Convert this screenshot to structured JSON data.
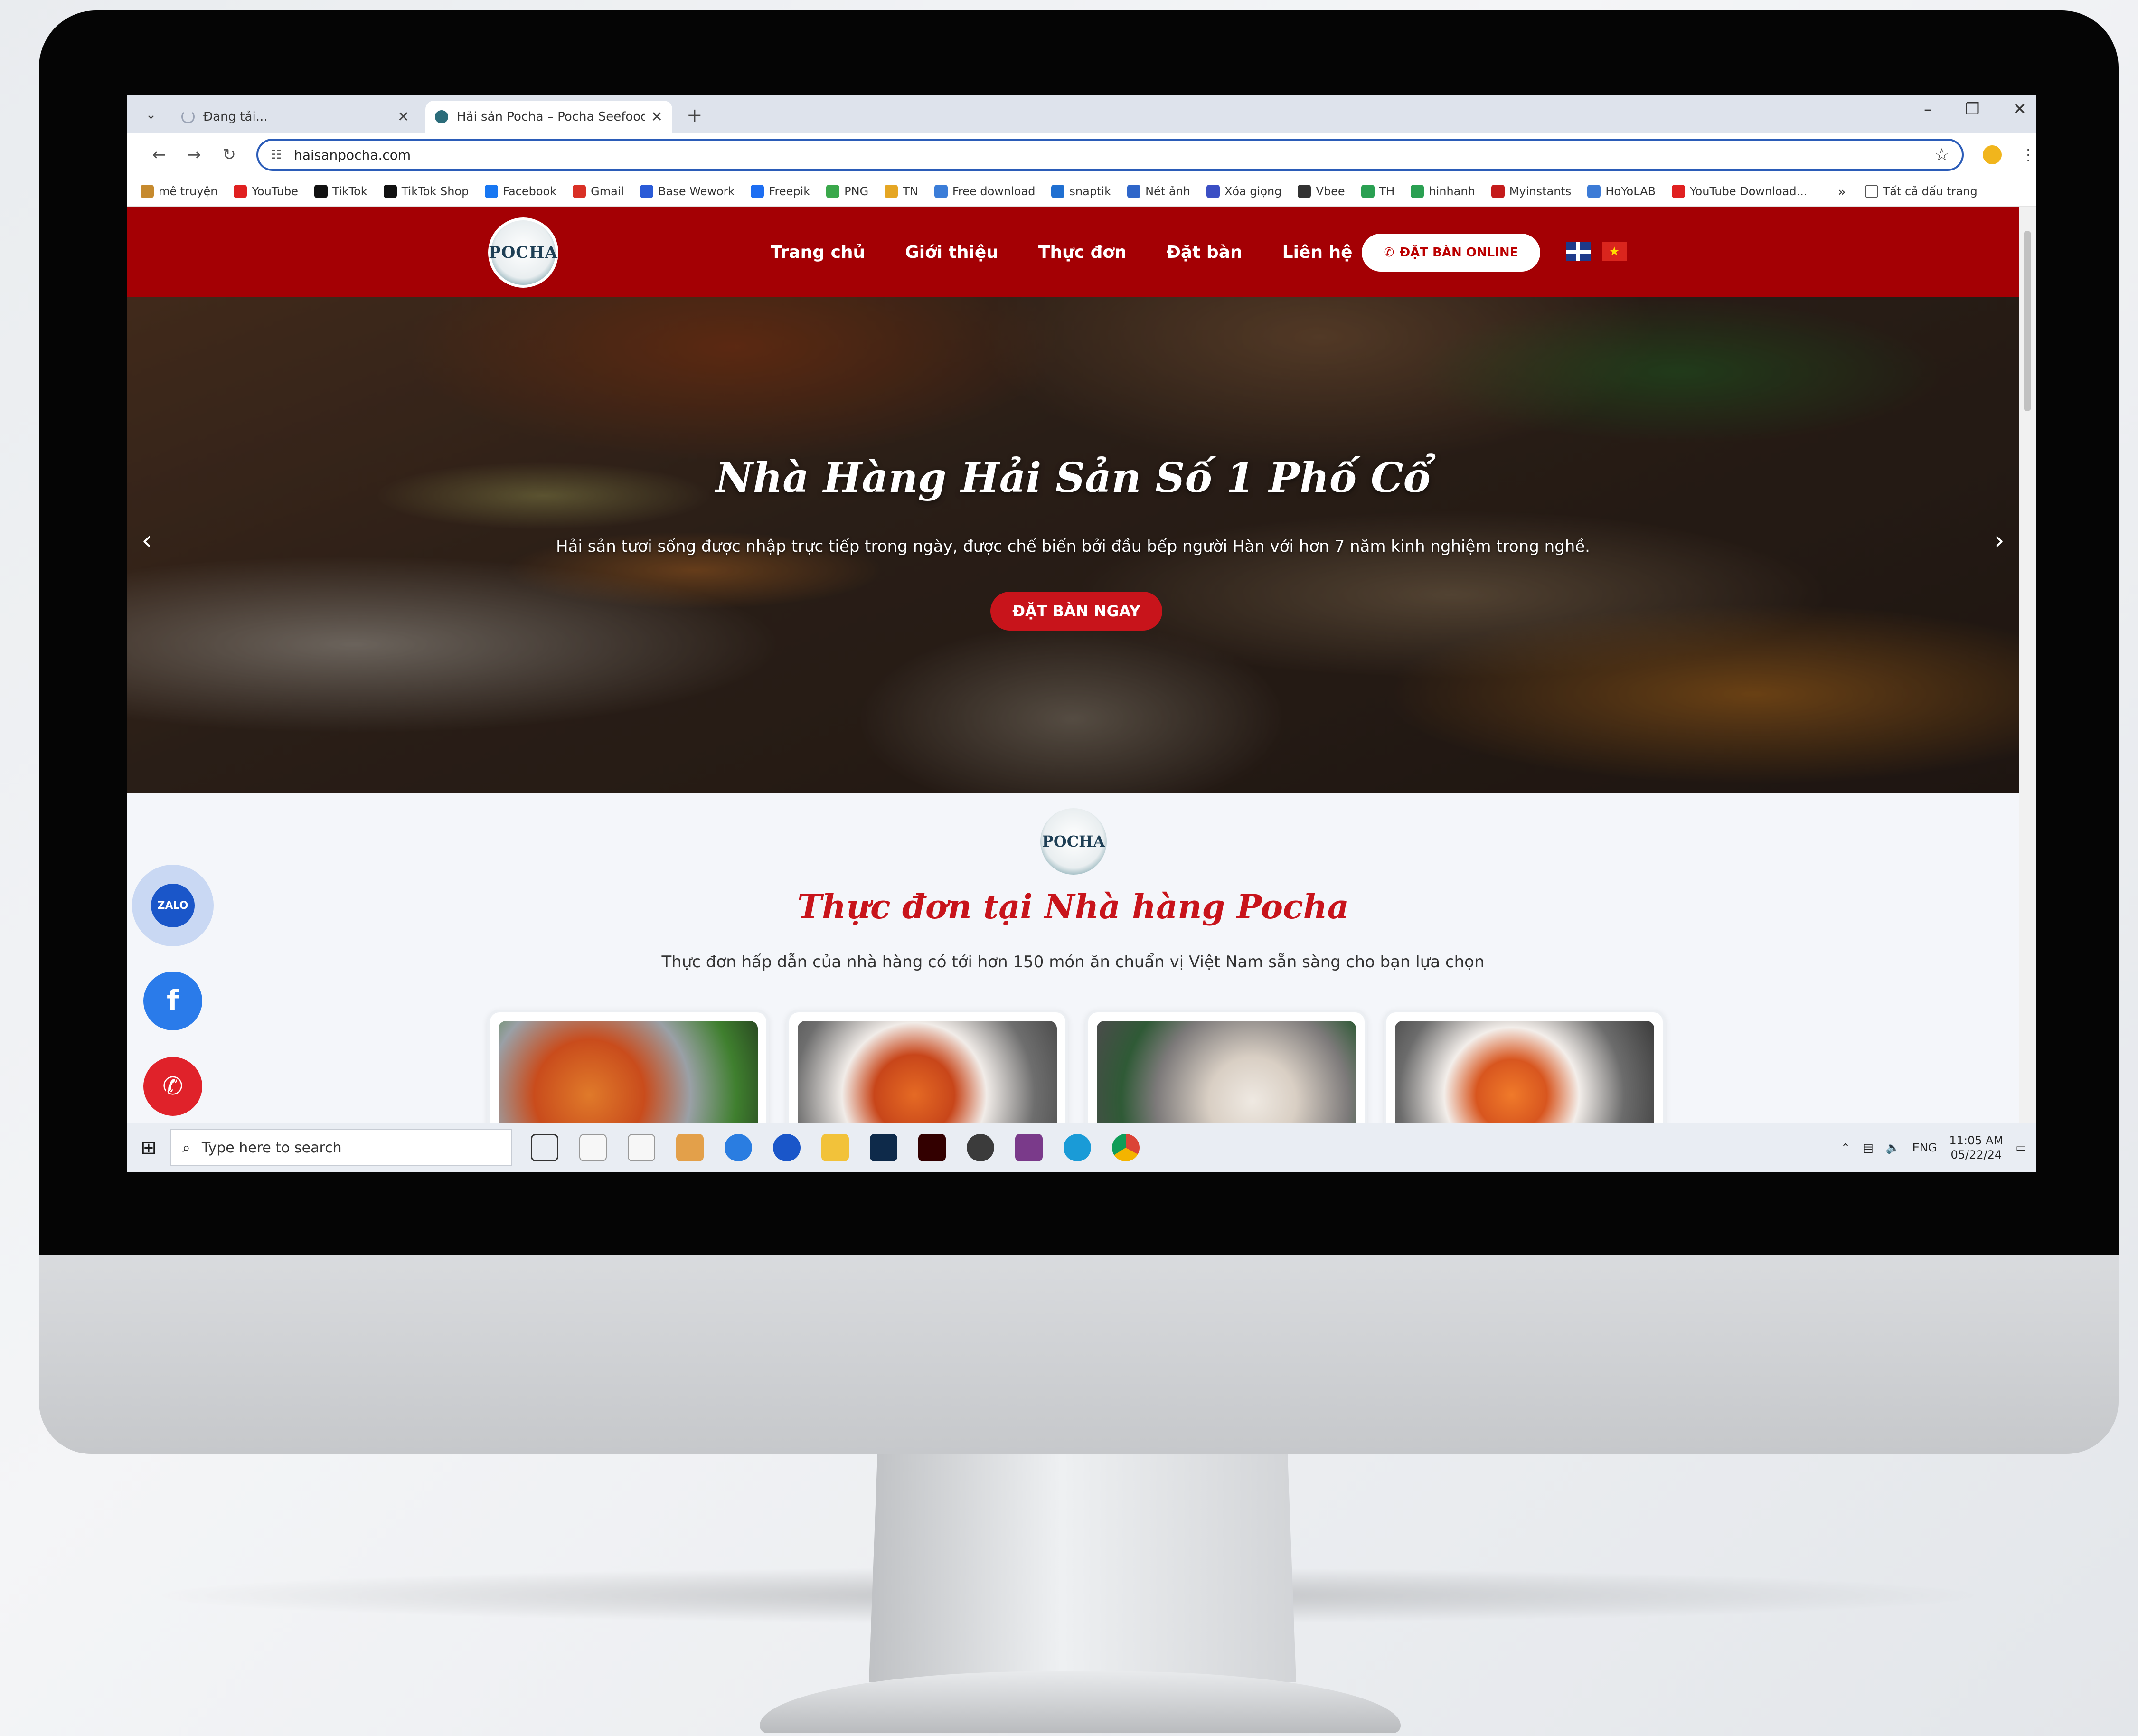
{
  "browser": {
    "tabs": [
      {
        "label": "Đang tải...",
        "active": false
      },
      {
        "label": "Hải sản Pocha – Pocha Seefood",
        "active": true
      }
    ],
    "url": "haisanpocha.com",
    "bookmarks": [
      {
        "label": "mê truyện",
        "color": "#c68a2e"
      },
      {
        "label": "YouTube",
        "color": "#e02020"
      },
      {
        "label": "TikTok",
        "color": "#111111"
      },
      {
        "label": "TikTok Shop",
        "color": "#111111"
      },
      {
        "label": "Facebook",
        "color": "#1877f2"
      },
      {
        "label": "Gmail",
        "color": "#d93025"
      },
      {
        "label": "Base Wework",
        "color": "#2a5bd7"
      },
      {
        "label": "Freepik",
        "color": "#1d6ef2"
      },
      {
        "label": "PNG",
        "color": "#3aa84b"
      },
      {
        "label": "TN",
        "color": "#e5a623"
      },
      {
        "label": "Free download",
        "color": "#3b7dd8"
      },
      {
        "label": "snaptik",
        "color": "#1f6fd1"
      },
      {
        "label": "Nét ảnh",
        "color": "#2f66c9"
      },
      {
        "label": "Xóa giọng",
        "color": "#3b4fc4"
      },
      {
        "label": "Vbee",
        "color": "#333333"
      },
      {
        "label": "TH",
        "color": "#2aa052"
      },
      {
        "label": "hinhanh",
        "color": "#2aa052"
      },
      {
        "label": "Myinstants",
        "color": "#c41b1b"
      },
      {
        "label": "HoYoLAB",
        "color": "#3c7bd6"
      },
      {
        "label": "YouTube Download...",
        "color": "#e02020"
      }
    ],
    "bookmarks_more": "»",
    "all_bookmarks": "Tất cả dấu trang"
  },
  "site": {
    "logo_text": "POCHA",
    "nav": [
      "Trang chủ",
      "Giới thiệu",
      "Thực đơn",
      "Đặt bàn",
      "Liên hệ"
    ],
    "cta_online": "ĐẶT BÀN ONLINE",
    "hero": {
      "title": "Nhà Hàng Hải Sản Số 1 Phố Cổ",
      "subtitle": "Hải sản tươi sống được nhập trực tiếp trong ngày, được chế biến bởi đầu bếp người Hàn với hơn 7 năm kinh nghiệm trong nghề.",
      "button": "ĐẶT BÀN NGAY"
    },
    "menu_section": {
      "title": "Thực đơn tại Nhà hàng Pocha",
      "subtitle": "Thực đơn hấp dẫn của nhà hàng có tới hơn 150 món ăn chuẩn vị Việt Nam sẵn sàng cho bạn lựa chọn"
    },
    "float": {
      "zalo": "ZALO",
      "facebook": "f",
      "phone": "✆"
    },
    "colors": {
      "brand_red": "#a40004",
      "accent_red": "#c8141b"
    }
  },
  "taskbar": {
    "search_placeholder": "Type here to search",
    "lang": "ENG",
    "time": "11:05 AM",
    "date": "05/22/24"
  }
}
